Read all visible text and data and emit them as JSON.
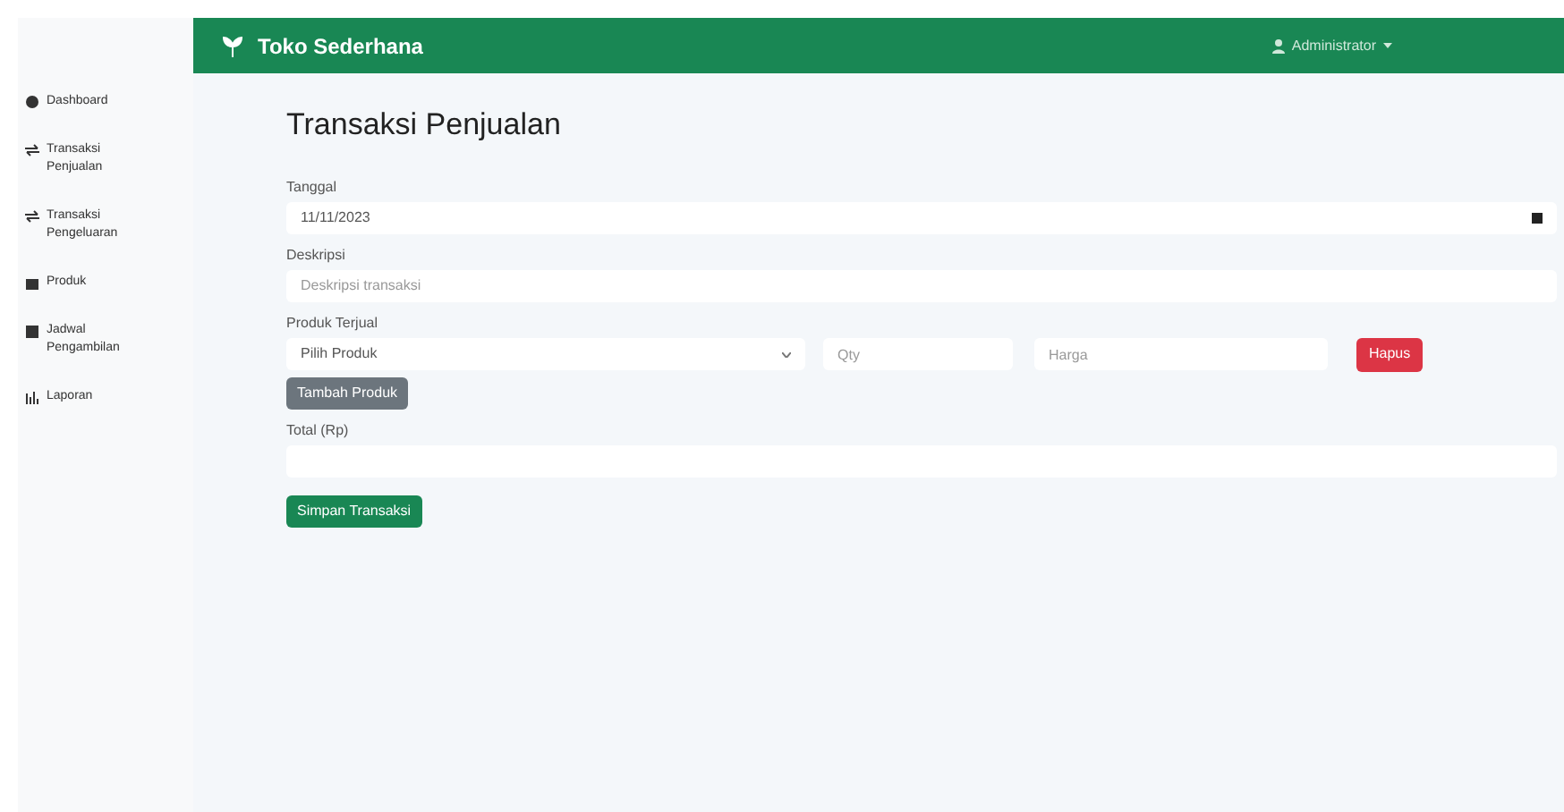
{
  "navbar": {
    "brand": "Toko Sederhana",
    "user": "Administrator"
  },
  "sidebar": {
    "items": [
      {
        "label": "Dashboard"
      },
      {
        "label": "Transaksi Penjualan"
      },
      {
        "label": "Transaksi Pengeluaran"
      },
      {
        "label": "Produk"
      },
      {
        "label": "Jadwal Pengambilan"
      },
      {
        "label": "Laporan"
      }
    ]
  },
  "page_title": "Transaksi Penjualan",
  "form": {
    "date": {
      "label": "Tanggal",
      "value": "11/11/2023"
    },
    "description": {
      "label": "Deskripsi",
      "placeholder": "Deskripsi transaksi"
    },
    "products": {
      "label": "Produk Terjual",
      "rows": [
        {
          "product": "Pilih Produk",
          "qty_placeholder": "Qty",
          "price_placeholder": "Harga",
          "remove": "Hapus"
        }
      ],
      "add_button": "Tambah Produk"
    },
    "total": {
      "label": "Total (Rp)"
    },
    "submit": "Simpan Transaksi"
  }
}
